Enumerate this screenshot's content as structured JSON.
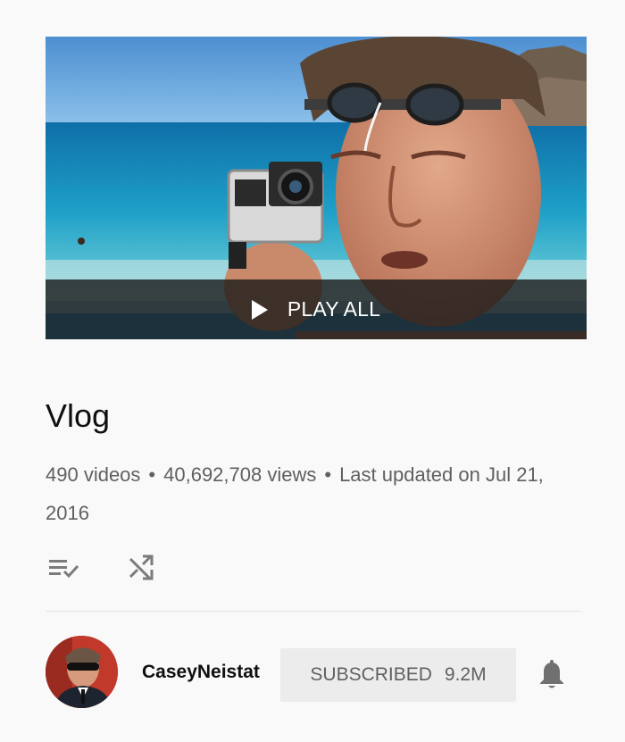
{
  "playlist": {
    "play_all_label": "PLAY ALL",
    "title": "Vlog",
    "stats": {
      "videos": "490 videos",
      "views": "40,692,708 views",
      "updated": "Last updated on Jul 21, 2016",
      "separator": "•"
    }
  },
  "actions": {
    "icons": [
      "playlist-check-icon",
      "shuffle-icon"
    ]
  },
  "channel": {
    "name": "CaseyNeistat",
    "subscribe_label": "SUBSCRIBED",
    "subscriber_count": "9.2M",
    "bell_icon": "notification-bell-icon"
  },
  "colors": {
    "background": "#f9f9f9",
    "text_primary": "#0f0f0f",
    "text_secondary": "#606060",
    "subscribed_button_bg": "#ececec",
    "play_overlay": "#191919"
  }
}
